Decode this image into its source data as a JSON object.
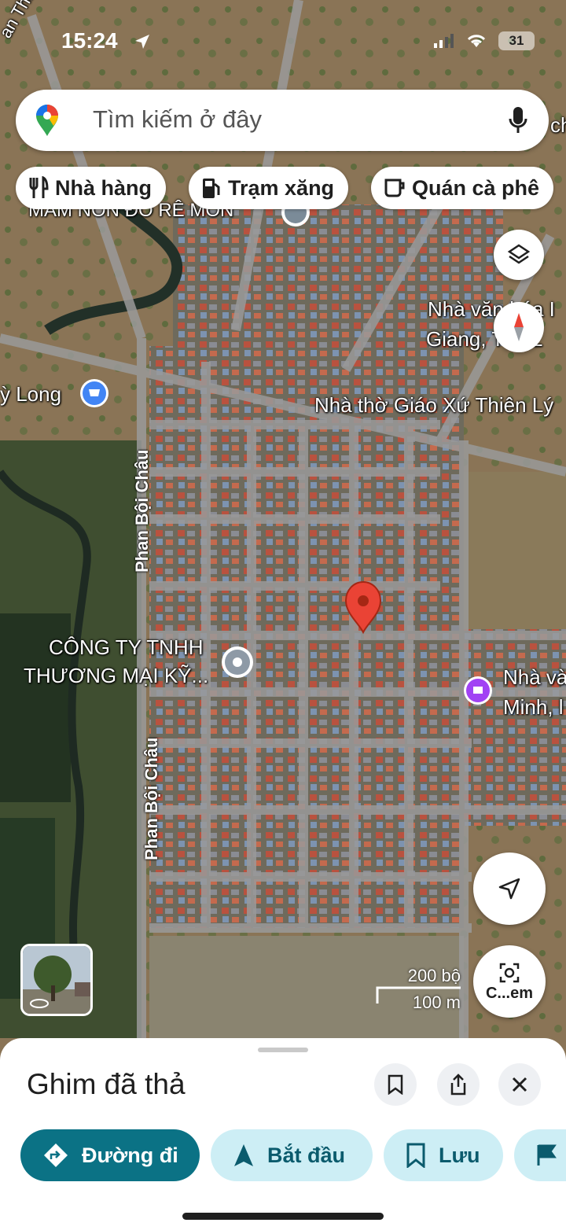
{
  "status_bar": {
    "time": "15:24",
    "battery": "31"
  },
  "search": {
    "placeholder": "Tìm kiếm ở đây"
  },
  "chips": [
    {
      "label": "Nhà hàng",
      "icon": "restaurant-icon"
    },
    {
      "label": "Trạm xăng",
      "icon": "gas-station-icon"
    },
    {
      "label": "Quán cà phê",
      "icon": "coffee-icon"
    }
  ],
  "map": {
    "labels": {
      "top_left_road": "an Thiện",
      "kindergarten": "MẦM NON ĐÔ RÊ MON",
      "culture_house_ne_1": "Nhà văn hóa I",
      "culture_house_ne_2": "Giang, Tây L",
      "shop_left": "ỳ Long",
      "church": "Nhà thờ Giáo Xứ Thiên Lý",
      "road_1": "Phan Bội Châu",
      "road_2": "Phan Bội Châu",
      "company_1": "CÔNG TY TNHH",
      "company_2": "THƯƠNG MẠI KỸ...",
      "culture_house_e_1": "Nhà và",
      "culture_house_e_2": "Minh, l",
      "search_partial": "ch"
    },
    "scale": {
      "feet": "200 bộ",
      "meters": "100 m"
    },
    "lens_label": "C...em",
    "pin_color": "#ea4335"
  },
  "sheet": {
    "title": "Ghim đã thả",
    "actions": [
      {
        "label": "Đường đi",
        "icon": "directions-icon"
      },
      {
        "label": "Bắt đầu",
        "icon": "navigation-arrow-icon"
      },
      {
        "label": "Lưu",
        "icon": "bookmark-icon"
      },
      {
        "label": "",
        "icon": "flag-icon"
      }
    ]
  },
  "colors": {
    "accent": "#0b7285",
    "secondary": "#cdeef5"
  }
}
